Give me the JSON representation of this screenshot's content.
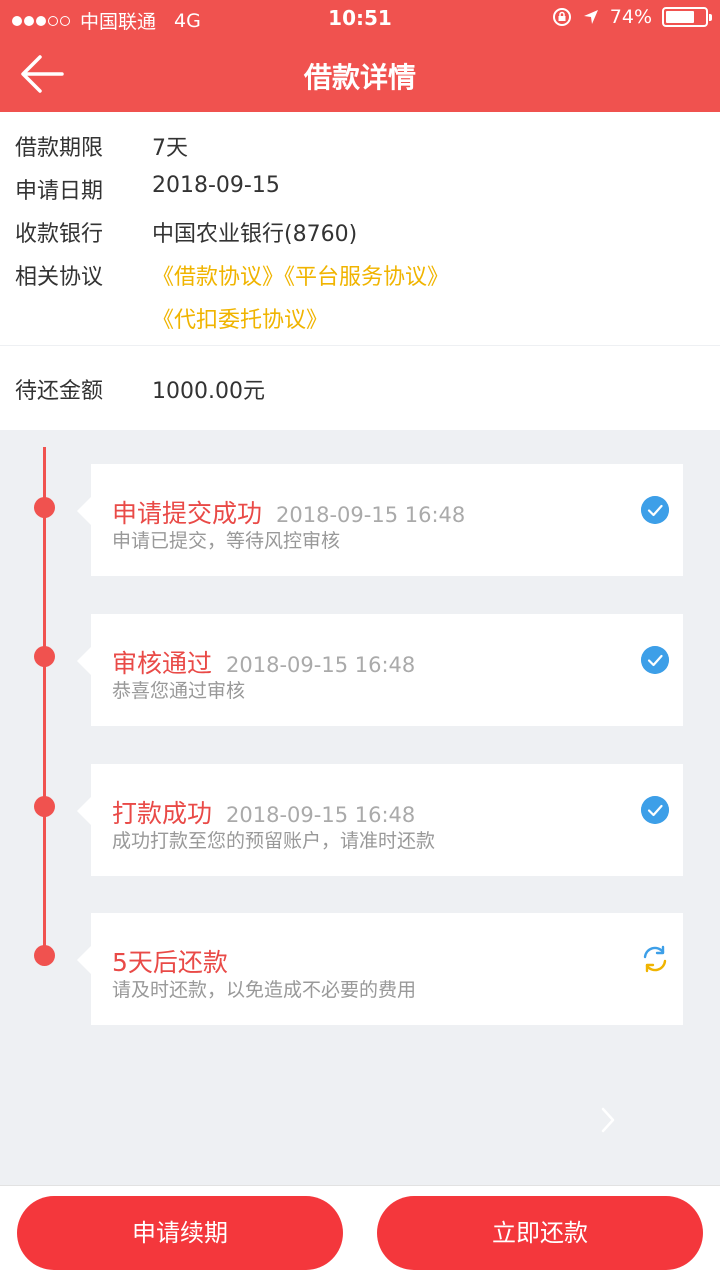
{
  "status_bar": {
    "carrier": "中国联通",
    "network": "4G",
    "time": "10:51",
    "battery": "74%",
    "battery_level": 0.74
  },
  "nav": {
    "title": "借款详情"
  },
  "info": {
    "term_label": "借款期限",
    "term_value": "7天",
    "date_label": "申请日期",
    "date_value": "2018-09-15",
    "bank_label": "收款银行",
    "bank_value": "中国农业银行(8760)",
    "agreements_label": "相关协议",
    "agreements": [
      "《借款协议》",
      "《平台服务协议》",
      "《代扣委托协议》"
    ]
  },
  "amount": {
    "label": "待还金额",
    "value": "1000.00元"
  },
  "timeline": [
    {
      "title": "申请提交成功",
      "time": "2018-09-15 16:48",
      "desc": "申请已提交，等待风控审核",
      "status": "done"
    },
    {
      "title": "审核通过",
      "time": "2018-09-15 16:48",
      "desc": "恭喜您通过审核",
      "status": "done"
    },
    {
      "title": "打款成功",
      "time": "2018-09-15 16:48",
      "desc": "成功打款至您的预留账户，请准时还款",
      "status": "done"
    },
    {
      "title": "5天后还款",
      "time": "",
      "desc": "请及时还款，以免造成不必要的费用",
      "status": "pending"
    }
  ],
  "buttons": {
    "renew": "申请续期",
    "repay": "立即还款"
  },
  "colors": {
    "brand": "#f0524f",
    "button": "#f4373c",
    "link": "#f0b400",
    "check": "#3d9fe8"
  }
}
